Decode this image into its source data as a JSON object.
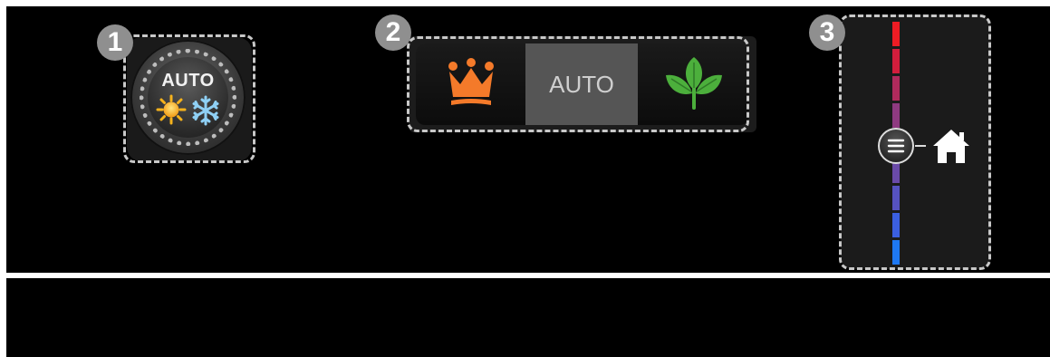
{
  "callouts": {
    "one": "1",
    "two": "2",
    "three": "3"
  },
  "climate_knob": {
    "label": "AUTO",
    "icons": [
      "sun-icon",
      "snowflake-icon"
    ]
  },
  "mode_selector": {
    "segments": [
      {
        "icon": "crown-icon",
        "label": ""
      },
      {
        "icon": "",
        "label": "AUTO"
      },
      {
        "icon": "leaf-icon",
        "label": ""
      }
    ],
    "selected": "AUTO"
  },
  "temperature_slider": {
    "scale_colors": [
      "#ee1c24",
      "#d21d3c",
      "#b02a5c",
      "#8e3a80",
      "#7a3e95",
      "#6a4aa8",
      "#5652c0",
      "#3b5fe0",
      "#1e78f2"
    ],
    "handle_icon": "menu-lines-icon",
    "target_icon": "home-icon"
  },
  "colors": {
    "frame_dash": "#c8c8c8",
    "callout_bg": "#8f8f8f",
    "crown": "#f47a2a",
    "leaf": "#4caf3c"
  }
}
